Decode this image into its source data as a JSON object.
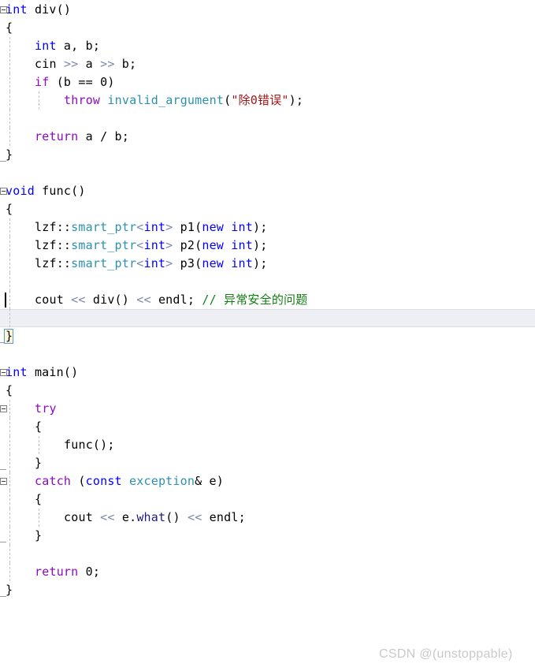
{
  "editor": {
    "title": "C++ source code editor",
    "language": "C++",
    "background_color": "#ffffff",
    "current_line_color": "#eeeef5",
    "font_size_px": 15,
    "line_height_px": 23,
    "caret": {
      "line_index": 16,
      "column": 0,
      "color": "#000000"
    }
  },
  "palette": {
    "keyword": "#0000ff",
    "control": "#8f08c4",
    "type": "#2b91af",
    "string": "#a31515",
    "comment": "#108010",
    "operator": "#7a88b0",
    "plain": "#000000",
    "gutter_guide": "#c3c3c3",
    "fold_marker": "#808080",
    "watermark": "#c9c9c9"
  },
  "watermark": {
    "text": "CSDN @(unstoppable)"
  },
  "code": {
    "lines": [
      {
        "n": 1,
        "indent": 0,
        "fold": "box",
        "tokens": [
          {
            "t": "int",
            "c": "kw"
          },
          {
            "t": " ",
            "c": "pln"
          },
          {
            "t": "div",
            "c": "pln"
          },
          {
            "t": "()",
            "c": "pln"
          }
        ]
      },
      {
        "n": 2,
        "indent": 0,
        "fold": "",
        "tokens": [
          {
            "t": "{",
            "c": "pln"
          }
        ]
      },
      {
        "n": 3,
        "indent": 1,
        "fold": "",
        "tokens": [
          {
            "t": "int",
            "c": "kw"
          },
          {
            "t": " a, b;",
            "c": "pln"
          }
        ]
      },
      {
        "n": 4,
        "indent": 1,
        "fold": "",
        "tokens": [
          {
            "t": "cin ",
            "c": "pln"
          },
          {
            "t": ">>",
            "c": "op"
          },
          {
            "t": " a ",
            "c": "pln"
          },
          {
            "t": ">>",
            "c": "op"
          },
          {
            "t": " b;",
            "c": "pln"
          }
        ]
      },
      {
        "n": 5,
        "indent": 1,
        "fold": "",
        "tokens": [
          {
            "t": "if",
            "c": "ctrl"
          },
          {
            "t": " (b == ",
            "c": "pln"
          },
          {
            "t": "0",
            "c": "num"
          },
          {
            "t": ")",
            "c": "pln"
          }
        ]
      },
      {
        "n": 6,
        "indent": 2,
        "fold": "",
        "tokens": [
          {
            "t": "throw",
            "c": "ctrl"
          },
          {
            "t": " ",
            "c": "pln"
          },
          {
            "t": "invalid_argument",
            "c": "type"
          },
          {
            "t": "(",
            "c": "pln"
          },
          {
            "t": "\"除0错误\"",
            "c": "str"
          },
          {
            "t": ");",
            "c": "pln"
          }
        ]
      },
      {
        "n": 7,
        "indent": 1,
        "fold": "",
        "tokens": []
      },
      {
        "n": 8,
        "indent": 1,
        "fold": "",
        "tokens": [
          {
            "t": "return",
            "c": "ctrl"
          },
          {
            "t": " a / b;",
            "c": "pln"
          }
        ]
      },
      {
        "n": 9,
        "indent": 0,
        "fold": "dash",
        "tokens": [
          {
            "t": "}",
            "c": "pln"
          }
        ]
      },
      {
        "n": 10,
        "indent": 0,
        "fold": "",
        "tokens": []
      },
      {
        "n": 11,
        "indent": 0,
        "fold": "box",
        "tokens": [
          {
            "t": "void",
            "c": "kw"
          },
          {
            "t": " ",
            "c": "pln"
          },
          {
            "t": "func",
            "c": "pln"
          },
          {
            "t": "()",
            "c": "pln"
          }
        ]
      },
      {
        "n": 12,
        "indent": 0,
        "fold": "",
        "tokens": [
          {
            "t": "{",
            "c": "pln"
          }
        ]
      },
      {
        "n": 13,
        "indent": 1,
        "fold": "",
        "tokens": [
          {
            "t": "lzf::",
            "c": "pln"
          },
          {
            "t": "smart_ptr",
            "c": "type"
          },
          {
            "t": "<",
            "c": "op"
          },
          {
            "t": "int",
            "c": "kw"
          },
          {
            "t": ">",
            "c": "op"
          },
          {
            "t": " p1(",
            "c": "pln"
          },
          {
            "t": "new",
            "c": "kw"
          },
          {
            "t": " ",
            "c": "pln"
          },
          {
            "t": "int",
            "c": "kw"
          },
          {
            "t": ");",
            "c": "pln"
          }
        ]
      },
      {
        "n": 14,
        "indent": 1,
        "fold": "",
        "tokens": [
          {
            "t": "lzf::",
            "c": "pln"
          },
          {
            "t": "smart_ptr",
            "c": "type"
          },
          {
            "t": "<",
            "c": "op"
          },
          {
            "t": "int",
            "c": "kw"
          },
          {
            "t": ">",
            "c": "op"
          },
          {
            "t": " p2(",
            "c": "pln"
          },
          {
            "t": "new",
            "c": "kw"
          },
          {
            "t": " ",
            "c": "pln"
          },
          {
            "t": "int",
            "c": "kw"
          },
          {
            "t": ");",
            "c": "pln"
          }
        ]
      },
      {
        "n": 15,
        "indent": 1,
        "fold": "",
        "tokens": [
          {
            "t": "lzf::",
            "c": "pln"
          },
          {
            "t": "smart_ptr",
            "c": "type"
          },
          {
            "t": "<",
            "c": "op"
          },
          {
            "t": "int",
            "c": "kw"
          },
          {
            "t": ">",
            "c": "op"
          },
          {
            "t": " p3(",
            "c": "pln"
          },
          {
            "t": "new",
            "c": "kw"
          },
          {
            "t": " ",
            "c": "pln"
          },
          {
            "t": "int",
            "c": "kw"
          },
          {
            "t": ");",
            "c": "pln"
          }
        ]
      },
      {
        "n": 16,
        "indent": 1,
        "fold": "",
        "tokens": []
      },
      {
        "n": 17,
        "indent": 1,
        "fold": "",
        "tokens": [
          {
            "t": "cout ",
            "c": "pln"
          },
          {
            "t": "<<",
            "c": "op"
          },
          {
            "t": " div() ",
            "c": "pln"
          },
          {
            "t": "<<",
            "c": "op"
          },
          {
            "t": " endl; ",
            "c": "pln"
          },
          {
            "t": "// 异常安全的问题",
            "c": "cmt"
          }
        ]
      },
      {
        "n": 18,
        "indent": 1,
        "fold": "",
        "current": true,
        "tokens": []
      },
      {
        "n": 19,
        "indent": 0,
        "fold": "dash",
        "brace_match": true,
        "tokens": [
          {
            "t": "}",
            "c": "pln"
          }
        ]
      },
      {
        "n": 20,
        "indent": 0,
        "fold": "",
        "tokens": []
      },
      {
        "n": 21,
        "indent": 0,
        "fold": "box",
        "tokens": [
          {
            "t": "int",
            "c": "kw"
          },
          {
            "t": " ",
            "c": "pln"
          },
          {
            "t": "main",
            "c": "pln"
          },
          {
            "t": "()",
            "c": "pln"
          }
        ]
      },
      {
        "n": 22,
        "indent": 0,
        "fold": "",
        "tokens": [
          {
            "t": "{",
            "c": "pln"
          }
        ]
      },
      {
        "n": 23,
        "indent": 1,
        "fold": "box",
        "tokens": [
          {
            "t": "try",
            "c": "ctrl"
          }
        ]
      },
      {
        "n": 24,
        "indent": 1,
        "fold": "",
        "tokens": [
          {
            "t": "{",
            "c": "pln"
          }
        ]
      },
      {
        "n": 25,
        "indent": 2,
        "fold": "",
        "tokens": [
          {
            "t": "func();",
            "c": "pln"
          }
        ]
      },
      {
        "n": 26,
        "indent": 1,
        "fold": "",
        "tokens": [
          {
            "t": "}",
            "c": "pln"
          }
        ]
      },
      {
        "n": 27,
        "indent": 1,
        "fold": "box2",
        "tokens": [
          {
            "t": "catch",
            "c": "ctrl"
          },
          {
            "t": " (",
            "c": "pln"
          },
          {
            "t": "const",
            "c": "kw"
          },
          {
            "t": " ",
            "c": "pln"
          },
          {
            "t": "exception",
            "c": "type"
          },
          {
            "t": "& e)",
            "c": "pln"
          }
        ]
      },
      {
        "n": 28,
        "indent": 1,
        "fold": "",
        "tokens": [
          {
            "t": "{",
            "c": "pln"
          }
        ]
      },
      {
        "n": 29,
        "indent": 2,
        "fold": "",
        "tokens": [
          {
            "t": "cout ",
            "c": "pln"
          },
          {
            "t": "<<",
            "c": "op"
          },
          {
            "t": " e.",
            "c": "pln"
          },
          {
            "t": "what",
            "c": "mem"
          },
          {
            "t": "() ",
            "c": "pln"
          },
          {
            "t": "<<",
            "c": "op"
          },
          {
            "t": " endl;",
            "c": "pln"
          }
        ]
      },
      {
        "n": 30,
        "indent": 1,
        "fold": "dash",
        "tokens": [
          {
            "t": "}",
            "c": "pln"
          }
        ]
      },
      {
        "n": 31,
        "indent": 1,
        "fold": "",
        "tokens": []
      },
      {
        "n": 32,
        "indent": 1,
        "fold": "",
        "tokens": [
          {
            "t": "return",
            "c": "ctrl"
          },
          {
            "t": " ",
            "c": "pln"
          },
          {
            "t": "0",
            "c": "num"
          },
          {
            "t": ";",
            "c": "pln"
          }
        ]
      },
      {
        "n": 33,
        "indent": 0,
        "fold": "dash",
        "tokens": [
          {
            "t": "}",
            "c": "pln"
          }
        ]
      }
    ]
  }
}
